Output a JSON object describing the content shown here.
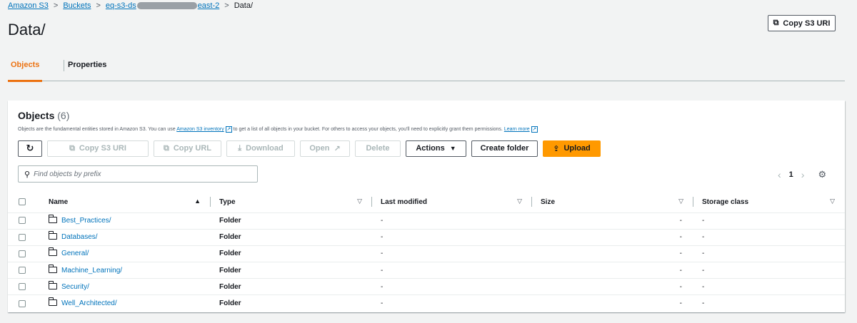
{
  "breadcrumb": {
    "root": "Amazon S3",
    "buckets": "Buckets",
    "bucket_prefix": "eq-s3-ds",
    "bucket_suffix": "east-2",
    "current": "Data/"
  },
  "page": {
    "title": "Data/",
    "copy_uri_label": "Copy S3 URI"
  },
  "tabs": [
    {
      "label": "Objects",
      "active": true
    },
    {
      "label": "Properties",
      "active": false
    }
  ],
  "objects_panel": {
    "heading": "Objects",
    "count": "(6)",
    "desc_part1": "Objects are the fundamental entities stored in Amazon S3. You can use ",
    "desc_link1": "Amazon S3 inventory",
    "desc_part2": " to get a list of all objects in your bucket. For others to access your objects, you'll need to explicitly grant them permissions. ",
    "desc_link2": "Learn more"
  },
  "toolbar": {
    "copy_s3_uri": "Copy S3 URI",
    "copy_url": "Copy URL",
    "download": "Download",
    "open": "Open",
    "delete": "Delete",
    "actions": "Actions",
    "create_folder": "Create folder",
    "upload": "Upload"
  },
  "search": {
    "placeholder": "Find objects by prefix"
  },
  "pagination": {
    "current_page": "1"
  },
  "table": {
    "headers": {
      "name": "Name",
      "type": "Type",
      "last_modified": "Last modified",
      "size": "Size",
      "storage_class": "Storage class"
    },
    "rows": [
      {
        "name": "Best_Practices/",
        "type": "Folder",
        "last_modified": "-",
        "size": "-",
        "storage_class": "-"
      },
      {
        "name": "Databases/",
        "type": "Folder",
        "last_modified": "-",
        "size": "-",
        "storage_class": "-"
      },
      {
        "name": "General/",
        "type": "Folder",
        "last_modified": "-",
        "size": "-",
        "storage_class": "-"
      },
      {
        "name": "Machine_Learning/",
        "type": "Folder",
        "last_modified": "-",
        "size": "-",
        "storage_class": "-"
      },
      {
        "name": "Security/",
        "type": "Folder",
        "last_modified": "-",
        "size": "-",
        "storage_class": "-"
      },
      {
        "name": "Well_Architected/",
        "type": "Folder",
        "last_modified": "-",
        "size": "-",
        "storage_class": "-"
      }
    ]
  },
  "colors": {
    "link": "#0073bb",
    "accent": "#ec7211",
    "primary_button": "#ff9900",
    "background": "#f2f3f3"
  },
  "icons": [
    "refresh-icon",
    "copy-icon",
    "download-icon",
    "external-link-icon",
    "caret-down-icon",
    "upload-icon",
    "search-icon",
    "chevron-left-icon",
    "chevron-right-icon",
    "settings-icon",
    "folder-icon",
    "sort-icon"
  ]
}
